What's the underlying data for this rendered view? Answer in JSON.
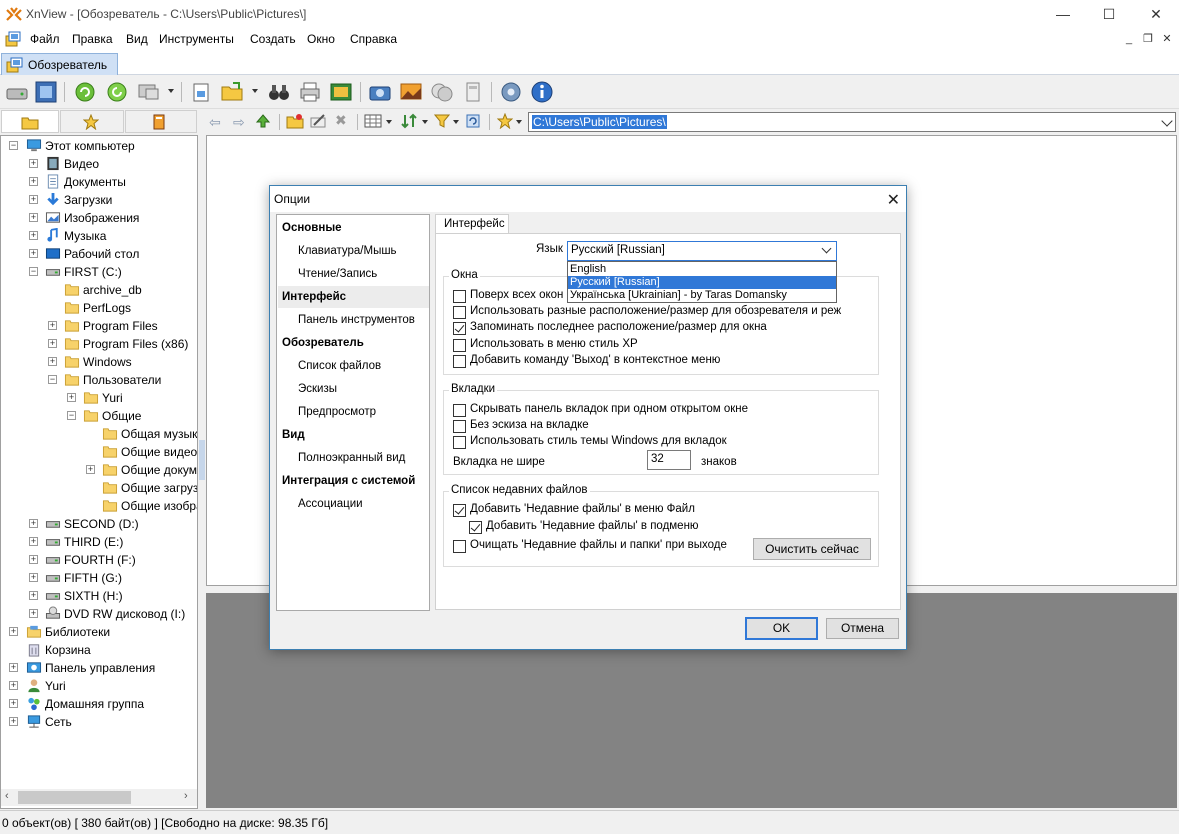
{
  "window": {
    "title": "XnView - [Обозреватель - C:\\Users\\Public\\Pictures\\]",
    "minimize": "—",
    "maximize": "☐",
    "close": "✕"
  },
  "menu": {
    "items": [
      "Файл",
      "Правка",
      "Вид",
      "Инструменты",
      "Создать",
      "Окно",
      "Справка"
    ],
    "mdi_minimize": "_",
    "mdi_restore": "❐",
    "mdi_close": "✕"
  },
  "tabs": [
    {
      "label": "Обозреватель"
    }
  ],
  "address": {
    "path": "C:\\Users\\Public\\Pictures\\"
  },
  "tree": {
    "items": [
      {
        "label": "Этот компьютер"
      },
      {
        "label": "Видео"
      },
      {
        "label": "Документы"
      },
      {
        "label": "Загрузки"
      },
      {
        "label": "Изображения"
      },
      {
        "label": "Музыка"
      },
      {
        "label": "Рабочий стол"
      },
      {
        "label": "FIRST (C:)"
      },
      {
        "label": "archive_db"
      },
      {
        "label": "PerfLogs"
      },
      {
        "label": "Program Files"
      },
      {
        "label": "Program Files (x86)"
      },
      {
        "label": "Windows"
      },
      {
        "label": "Пользователи"
      },
      {
        "label": "Yuri"
      },
      {
        "label": "Общие"
      },
      {
        "label": "Общая музыка"
      },
      {
        "label": "Общие видео"
      },
      {
        "label": "Общие документы"
      },
      {
        "label": "Общие загрузки"
      },
      {
        "label": "Общие изображения"
      },
      {
        "label": "SECOND (D:)"
      },
      {
        "label": "THIRD (E:)"
      },
      {
        "label": "FOURTH (F:)"
      },
      {
        "label": "FIFTH (G:)"
      },
      {
        "label": "SIXTH (H:)"
      },
      {
        "label": "DVD RW дисковод (I:)"
      },
      {
        "label": "Библиотеки"
      },
      {
        "label": "Корзина"
      },
      {
        "label": "Панель управления"
      },
      {
        "label": "Yuri"
      },
      {
        "label": "Домашняя группа"
      },
      {
        "label": "Сеть"
      }
    ]
  },
  "status": {
    "text": "0 объект(ов) [ 380 байт(ов) ] [Свободно на диске: 98.35 Гб]"
  },
  "dialog": {
    "title": "Опции",
    "close": "✕",
    "categories": [
      {
        "label": "Основные"
      },
      {
        "label": "Клавиатура/Мышь"
      },
      {
        "label": "Чтение/Запись"
      },
      {
        "label": "Интерфейс"
      },
      {
        "label": "Панель инструментов"
      },
      {
        "label": "Обозреватель"
      },
      {
        "label": "Список файлов"
      },
      {
        "label": "Эскизы"
      },
      {
        "label": "Предпросмотр"
      },
      {
        "label": "Вид"
      },
      {
        "label": "Полноэкранный вид"
      },
      {
        "label": "Интеграция с системой"
      },
      {
        "label": "Ассоциации"
      }
    ],
    "page_tab": "Интерфейс",
    "language": {
      "label": "Язык",
      "value": "Русский [Russian]",
      "options": [
        "English",
        "Русский [Russian]",
        "Українська [Ukrainian] - by Taras Domansky"
      ]
    },
    "windows_group": {
      "title": "Окна",
      "options": [
        {
          "label": "Поверх всех окон",
          "checked": false
        },
        {
          "label": "Использовать разные расположение/размер для обозревателя и реж",
          "checked": false
        },
        {
          "label": "Запоминать последнее расположение/размер для окна",
          "checked": true
        },
        {
          "label": "Использовать в меню стиль XP",
          "checked": false
        },
        {
          "label": "Добавить команду 'Выход' в контекстное меню",
          "checked": false
        }
      ]
    },
    "tabs_group": {
      "title": "Вкладки",
      "options": [
        {
          "label": "Скрывать панель вкладок при одном открытом окне",
          "checked": false
        },
        {
          "label": "Без эскиза на вкладке",
          "checked": false
        },
        {
          "label": "Использовать стиль темы Windows для вкладок",
          "checked": false
        }
      ],
      "width_label": "Вкладка не шире",
      "width_value": "32",
      "width_unit": "знаков"
    },
    "recent_group": {
      "title": "Список недавних файлов",
      "options": [
        {
          "label": "Добавить 'Недавние файлы' в меню Файл",
          "checked": true
        },
        {
          "label": "Добавить 'Недавние файлы' в подменю",
          "checked": true
        },
        {
          "label": "Очищать 'Недавние файлы и папки' при выходе",
          "checked": false
        }
      ],
      "clear_button": "Очистить сейчас"
    },
    "ok": "OK",
    "cancel": "Отмена"
  }
}
